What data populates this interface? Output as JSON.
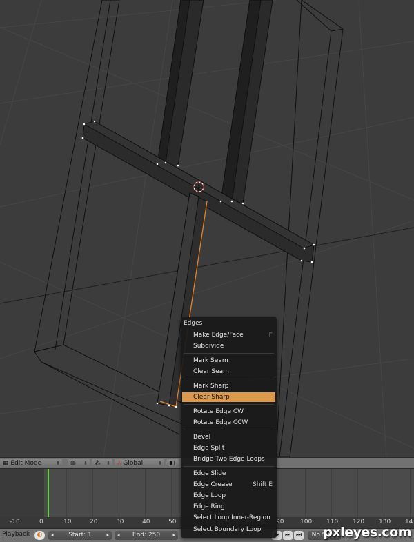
{
  "viewport": {
    "mode": "Edit Mode",
    "orientation": "Global"
  },
  "edges_menu": {
    "title": "Edges",
    "items": [
      {
        "label": "Make Edge/Face",
        "shortcut": "F"
      },
      {
        "label": "Subdivide",
        "shortcut": ""
      },
      {
        "label": "Mark Seam",
        "shortcut": ""
      },
      {
        "label": "Clear Seam",
        "shortcut": ""
      },
      {
        "label": "Mark Sharp",
        "shortcut": ""
      },
      {
        "label": "Clear Sharp",
        "shortcut": "",
        "active": true
      },
      {
        "label": "Rotate Edge CW",
        "shortcut": ""
      },
      {
        "label": "Rotate Edge CCW",
        "shortcut": ""
      },
      {
        "label": "Bevel",
        "shortcut": ""
      },
      {
        "label": "Edge Split",
        "shortcut": ""
      },
      {
        "label": "Bridge Two Edge Loops",
        "shortcut": ""
      },
      {
        "label": "Edge Slide",
        "shortcut": ""
      },
      {
        "label": "Edge Crease",
        "shortcut": "Shift E"
      },
      {
        "label": "Edge Loop",
        "shortcut": ""
      },
      {
        "label": "Edge Ring",
        "shortcut": ""
      },
      {
        "label": "Select Loop Inner-Region",
        "shortcut": ""
      },
      {
        "label": "Select Boundary Loop",
        "shortcut": ""
      }
    ]
  },
  "timeline": {
    "ticks": [
      "-10",
      "0",
      "10",
      "20",
      "30",
      "40",
      "50",
      "90",
      "100",
      "110",
      "120",
      "130",
      "14"
    ],
    "current_frame": 1
  },
  "playback": {
    "label": "Playback",
    "start": "Start: 1",
    "end": "End: 250",
    "sync": "No Sync"
  },
  "watermark": "pxleyes.com",
  "colors": {
    "menu_highlight": "#d99a4e",
    "selection_orange": "#e8822a",
    "current_frame_line": "#5bd43a"
  }
}
